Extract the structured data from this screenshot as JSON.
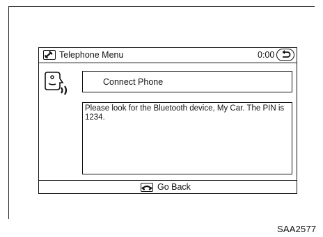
{
  "header": {
    "title": "Telephone Menu",
    "timer": "0:00",
    "title_icon": "phone-icon",
    "back_icon": "back-arrow-icon"
  },
  "voice_icon": "voice-command-icon",
  "command": {
    "label": "Connect Phone"
  },
  "message": "Please look for the Bluetooth device, My Car. The PIN is 1234.",
  "footer": {
    "label": "Go Back",
    "icon": "hang-up-icon"
  },
  "figure_code": "SAA2577"
}
